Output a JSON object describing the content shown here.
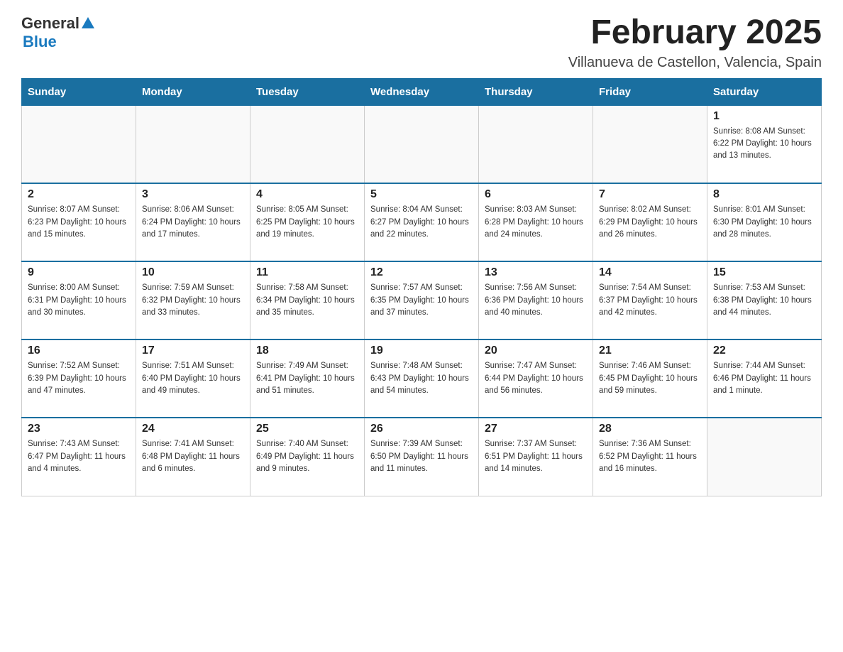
{
  "header": {
    "logo": {
      "general": "General",
      "blue": "Blue"
    },
    "title": "February 2025",
    "location": "Villanueva de Castellon, Valencia, Spain"
  },
  "calendar": {
    "days_of_week": [
      "Sunday",
      "Monday",
      "Tuesday",
      "Wednesday",
      "Thursday",
      "Friday",
      "Saturday"
    ],
    "weeks": [
      [
        {
          "day": "",
          "info": ""
        },
        {
          "day": "",
          "info": ""
        },
        {
          "day": "",
          "info": ""
        },
        {
          "day": "",
          "info": ""
        },
        {
          "day": "",
          "info": ""
        },
        {
          "day": "",
          "info": ""
        },
        {
          "day": "1",
          "info": "Sunrise: 8:08 AM\nSunset: 6:22 PM\nDaylight: 10 hours and 13 minutes."
        }
      ],
      [
        {
          "day": "2",
          "info": "Sunrise: 8:07 AM\nSunset: 6:23 PM\nDaylight: 10 hours and 15 minutes."
        },
        {
          "day": "3",
          "info": "Sunrise: 8:06 AM\nSunset: 6:24 PM\nDaylight: 10 hours and 17 minutes."
        },
        {
          "day": "4",
          "info": "Sunrise: 8:05 AM\nSunset: 6:25 PM\nDaylight: 10 hours and 19 minutes."
        },
        {
          "day": "5",
          "info": "Sunrise: 8:04 AM\nSunset: 6:27 PM\nDaylight: 10 hours and 22 minutes."
        },
        {
          "day": "6",
          "info": "Sunrise: 8:03 AM\nSunset: 6:28 PM\nDaylight: 10 hours and 24 minutes."
        },
        {
          "day": "7",
          "info": "Sunrise: 8:02 AM\nSunset: 6:29 PM\nDaylight: 10 hours and 26 minutes."
        },
        {
          "day": "8",
          "info": "Sunrise: 8:01 AM\nSunset: 6:30 PM\nDaylight: 10 hours and 28 minutes."
        }
      ],
      [
        {
          "day": "9",
          "info": "Sunrise: 8:00 AM\nSunset: 6:31 PM\nDaylight: 10 hours and 30 minutes."
        },
        {
          "day": "10",
          "info": "Sunrise: 7:59 AM\nSunset: 6:32 PM\nDaylight: 10 hours and 33 minutes."
        },
        {
          "day": "11",
          "info": "Sunrise: 7:58 AM\nSunset: 6:34 PM\nDaylight: 10 hours and 35 minutes."
        },
        {
          "day": "12",
          "info": "Sunrise: 7:57 AM\nSunset: 6:35 PM\nDaylight: 10 hours and 37 minutes."
        },
        {
          "day": "13",
          "info": "Sunrise: 7:56 AM\nSunset: 6:36 PM\nDaylight: 10 hours and 40 minutes."
        },
        {
          "day": "14",
          "info": "Sunrise: 7:54 AM\nSunset: 6:37 PM\nDaylight: 10 hours and 42 minutes."
        },
        {
          "day": "15",
          "info": "Sunrise: 7:53 AM\nSunset: 6:38 PM\nDaylight: 10 hours and 44 minutes."
        }
      ],
      [
        {
          "day": "16",
          "info": "Sunrise: 7:52 AM\nSunset: 6:39 PM\nDaylight: 10 hours and 47 minutes."
        },
        {
          "day": "17",
          "info": "Sunrise: 7:51 AM\nSunset: 6:40 PM\nDaylight: 10 hours and 49 minutes."
        },
        {
          "day": "18",
          "info": "Sunrise: 7:49 AM\nSunset: 6:41 PM\nDaylight: 10 hours and 51 minutes."
        },
        {
          "day": "19",
          "info": "Sunrise: 7:48 AM\nSunset: 6:43 PM\nDaylight: 10 hours and 54 minutes."
        },
        {
          "day": "20",
          "info": "Sunrise: 7:47 AM\nSunset: 6:44 PM\nDaylight: 10 hours and 56 minutes."
        },
        {
          "day": "21",
          "info": "Sunrise: 7:46 AM\nSunset: 6:45 PM\nDaylight: 10 hours and 59 minutes."
        },
        {
          "day": "22",
          "info": "Sunrise: 7:44 AM\nSunset: 6:46 PM\nDaylight: 11 hours and 1 minute."
        }
      ],
      [
        {
          "day": "23",
          "info": "Sunrise: 7:43 AM\nSunset: 6:47 PM\nDaylight: 11 hours and 4 minutes."
        },
        {
          "day": "24",
          "info": "Sunrise: 7:41 AM\nSunset: 6:48 PM\nDaylight: 11 hours and 6 minutes."
        },
        {
          "day": "25",
          "info": "Sunrise: 7:40 AM\nSunset: 6:49 PM\nDaylight: 11 hours and 9 minutes."
        },
        {
          "day": "26",
          "info": "Sunrise: 7:39 AM\nSunset: 6:50 PM\nDaylight: 11 hours and 11 minutes."
        },
        {
          "day": "27",
          "info": "Sunrise: 7:37 AM\nSunset: 6:51 PM\nDaylight: 11 hours and 14 minutes."
        },
        {
          "day": "28",
          "info": "Sunrise: 7:36 AM\nSunset: 6:52 PM\nDaylight: 11 hours and 16 minutes."
        },
        {
          "day": "",
          "info": ""
        }
      ]
    ]
  }
}
